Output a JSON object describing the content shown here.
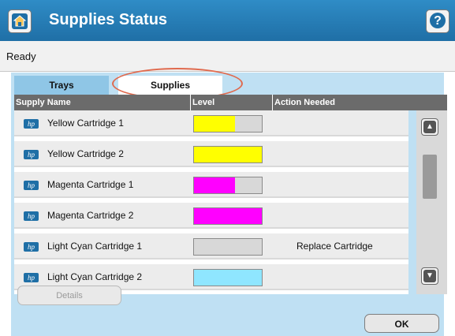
{
  "header": {
    "title": "Supplies Status",
    "home_icon": "home-icon",
    "help_label": "?"
  },
  "status": {
    "text": "Ready"
  },
  "tabs": [
    {
      "label": "Trays",
      "selected": false
    },
    {
      "label": "Supplies",
      "selected": true
    }
  ],
  "table": {
    "columns": [
      "Supply Name",
      "Level",
      "Action Needed"
    ],
    "rows": [
      {
        "name": "Yellow Cartridge 1",
        "level": 0.6,
        "color": "#ffff00",
        "action": ""
      },
      {
        "name": "Yellow Cartridge 2",
        "level": 1.0,
        "color": "#ffff00",
        "action": ""
      },
      {
        "name": "Magenta Cartridge 1",
        "level": 0.6,
        "color": "#ff00ff",
        "action": ""
      },
      {
        "name": "Magenta Cartridge 2",
        "level": 1.0,
        "color": "#ff00ff",
        "action": ""
      },
      {
        "name": "Light Cyan Cartridge 1",
        "level": 0.0,
        "color": "#8fe6ff",
        "action": "Replace Cartridge"
      },
      {
        "name": "Light Cyan Cartridge 2",
        "level": 1.0,
        "color": "#8fe6ff",
        "action": ""
      }
    ]
  },
  "buttons": {
    "details": "Details",
    "ok": "OK"
  },
  "colors": {
    "header": "#1f6fa6",
    "panel": "#bfe0f3",
    "highlight_circle": "#e06a4e"
  }
}
